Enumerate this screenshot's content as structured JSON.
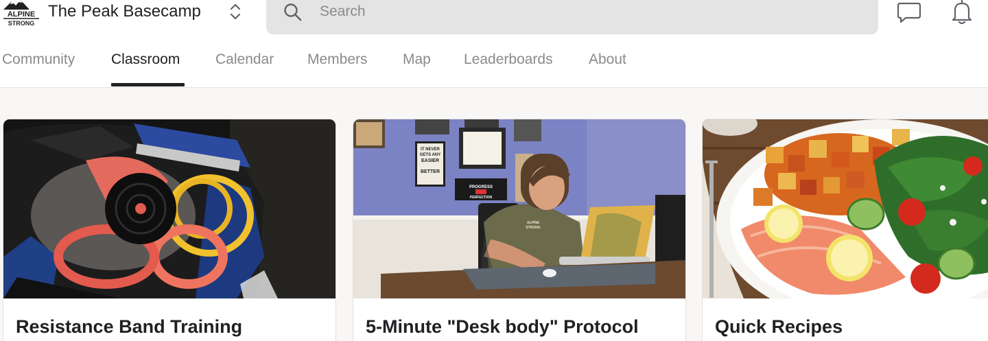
{
  "brand": {
    "logo_line1": "ALPINE",
    "logo_line2": "STRONG",
    "group_name": "The Peak Basecamp"
  },
  "search": {
    "placeholder": "Search"
  },
  "icons": {
    "switcher": "chevron-up-down-icon",
    "search": "search-icon",
    "chat": "chat-bubble-icon",
    "notifications": "bell-icon"
  },
  "tabs": [
    {
      "label": "Community",
      "active": false
    },
    {
      "label": "Classroom",
      "active": true
    },
    {
      "label": "Calendar",
      "active": false
    },
    {
      "label": "Members",
      "active": false
    },
    {
      "label": "Map",
      "active": false
    },
    {
      "label": "Leaderboards",
      "active": false
    },
    {
      "label": "About",
      "active": false
    }
  ],
  "courses": [
    {
      "title": "Resistance Band Training",
      "image": "gym bag with resistance bands"
    },
    {
      "title": "5-Minute \"Desk body\" Protocol",
      "image": "man smiling at laptop at a desk"
    },
    {
      "title": "Quick Recipes",
      "image": "salmon with roasted potatoes and salad"
    }
  ],
  "photo_text": {
    "sign1_l1": "IT NEVER",
    "sign1_l2": "GETS ANY",
    "sign1_l3": "EASIER",
    "sign1_l4": "BETTER",
    "sign2_l1": "PROGRESS",
    "sign2_l2": "PERFECTION",
    "shirt_l1": "ALPINE",
    "shirt_l2": "STRONG"
  },
  "colors": {
    "background": "#f8f7f5",
    "surface": "#ffffff",
    "search_bg": "#e4e4e4",
    "text_primary": "#202124",
    "text_muted": "#8a8a8a"
  }
}
